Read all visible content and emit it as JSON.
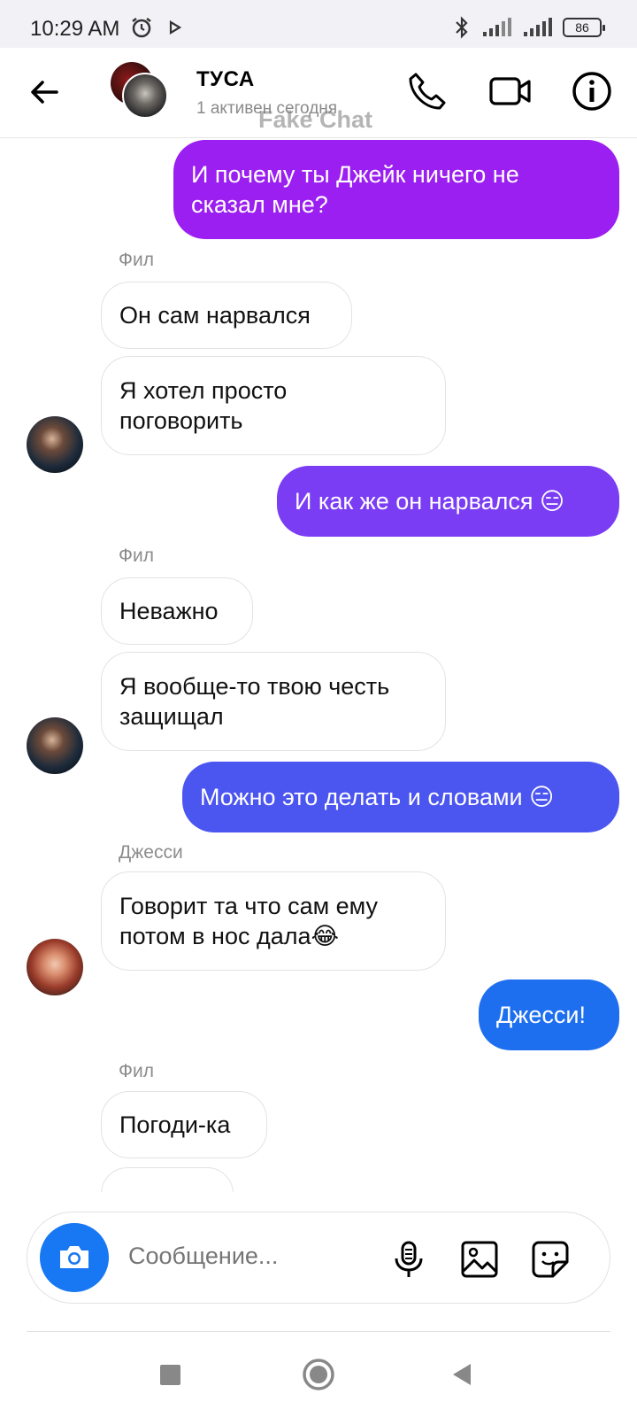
{
  "status_bar": {
    "time": "10:29 AM",
    "battery": "86",
    "icons": [
      "alarm-icon",
      "play-icon",
      "bluetooth-icon",
      "signal-icon",
      "signal-icon",
      "battery-icon"
    ]
  },
  "header": {
    "title": "ТУСА",
    "subtitle": "1 активен сегодня",
    "watermark": "Fake Chat"
  },
  "messages": [
    {
      "from": "me",
      "text": "И почему ты Джейк ничего не сказал мне?",
      "color": "#9b1ff0"
    },
    {
      "from": "Фил",
      "sender_label": "Фил",
      "text": "Он сам нарвался"
    },
    {
      "from": "Фил",
      "text": "Я хотел просто поговорить"
    },
    {
      "from": "me",
      "text": "И как же он нарвался 😑",
      "color": "#7a3df4"
    },
    {
      "from": "Фил",
      "sender_label": "Фил",
      "text": "Неважно"
    },
    {
      "from": "Фил",
      "text": "Я вообще-то твою честь защищал"
    },
    {
      "from": "me",
      "text": "Можно это делать и словами 😑",
      "color": "#4b55ef"
    },
    {
      "from": "Джесси",
      "sender_label": "Джесси",
      "text": "Говорит та что сам ему потом в нос дала😂"
    },
    {
      "from": "me",
      "text": "Джесси!",
      "color": "#1e6ff0"
    },
    {
      "from": "Фил",
      "sender_label": "Фил",
      "text": "Погоди-ка"
    }
  ],
  "composer": {
    "placeholder": "Сообщение..."
  },
  "colors": {
    "accent_blue": "#1877f2",
    "incoming_bg": "#ffffff"
  }
}
